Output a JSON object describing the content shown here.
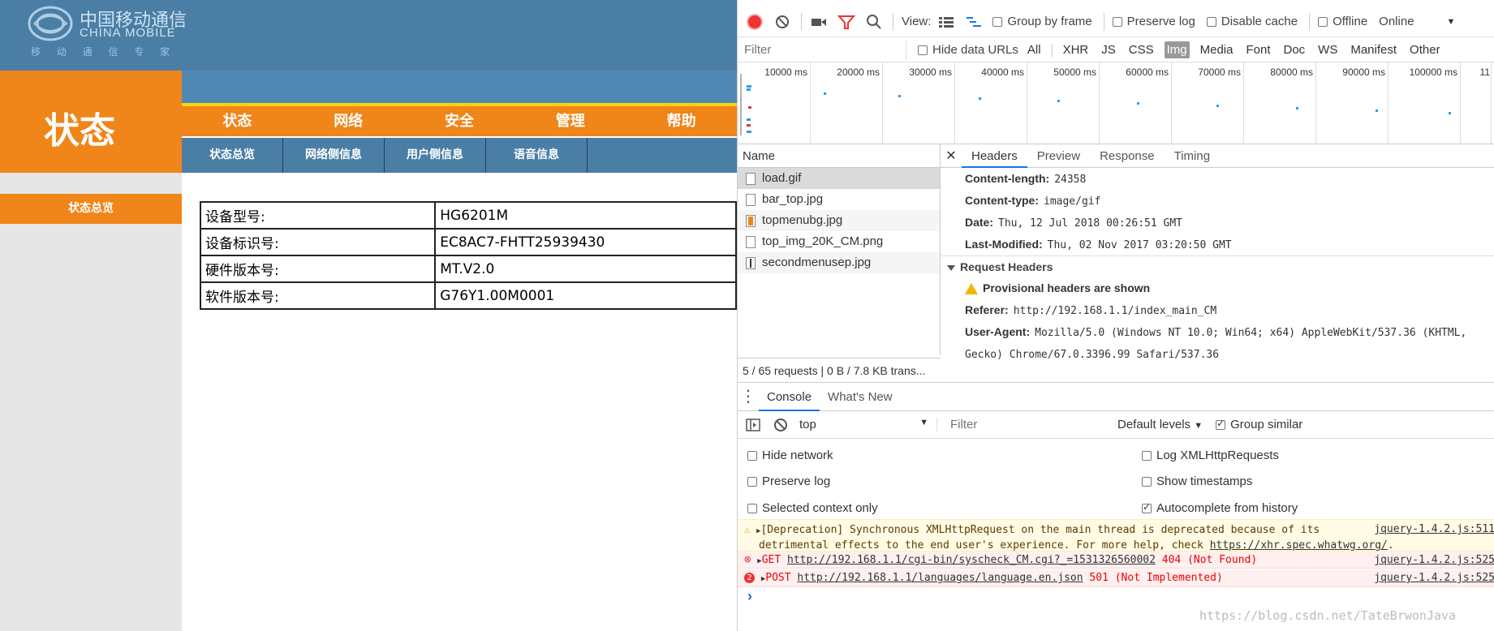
{
  "router": {
    "logo_cn": "中国移动通信",
    "logo_en": "CHINA MOBILE",
    "logo_slogan": "移 动 通 信 专 家",
    "page_title": "状态",
    "menu": [
      "状态",
      "网络",
      "安全",
      "管理",
      "帮助"
    ],
    "submenu": [
      "状态总览",
      "网络侧信息",
      "用户侧信息",
      "语音信息"
    ],
    "sidebar_active": "状态总览",
    "info_rows": [
      {
        "key": "设备型号:",
        "value": "HG6201M"
      },
      {
        "key": "设备标识号:",
        "value": "EC8AC7-FHTT25939430"
      },
      {
        "key": "硬件版本号:",
        "value": "MT.V2.0"
      },
      {
        "key": "软件版本号:",
        "value": "G76Y1.00M0001"
      }
    ],
    "colors": {
      "orange": "#f08519",
      "blue": "#4a7ea5",
      "yellow": "#fbd40a"
    }
  },
  "devtools": {
    "toolbar": {
      "view_label": "View:",
      "group_by_frame": "Group by frame",
      "preserve_log": "Preserve log",
      "disable_cache": "Disable cache",
      "offline": "Offline",
      "throttle": "Online"
    },
    "filter": {
      "placeholder": "Filter",
      "hide_data_urls": "Hide data URLs",
      "types": [
        "All",
        "XHR",
        "JS",
        "CSS",
        "Img",
        "Media",
        "Font",
        "Doc",
        "WS",
        "Manifest",
        "Other"
      ],
      "active_type": "Img"
    },
    "timeline_ticks": [
      "10000 ms",
      "20000 ms",
      "30000 ms",
      "40000 ms",
      "50000 ms",
      "60000 ms",
      "70000 ms",
      "80000 ms",
      "90000 ms",
      "100000 ms",
      "11"
    ],
    "name_header": "Name",
    "files": [
      {
        "name": "load.gif",
        "icon_color": "#ffffff"
      },
      {
        "name": "bar_top.jpg",
        "icon_color": "#ffffff"
      },
      {
        "name": "topmenubg.jpg",
        "icon_color": "#f08519"
      },
      {
        "name": "top_img_20K_CM.png",
        "icon_color": "#ffffff"
      },
      {
        "name": "secondmenusep.jpg",
        "icon_color": "#333333"
      }
    ],
    "status": "5 / 65 requests  |  0 B / 7.8 KB trans...",
    "detail_tabs": [
      "Headers",
      "Preview",
      "Response",
      "Timing"
    ],
    "response_headers": [
      {
        "k": "Content-length:",
        "v": "24358"
      },
      {
        "k": "Content-type:",
        "v": "image/gif"
      },
      {
        "k": "Date:",
        "v": "Thu, 12 Jul 2018 00:26:51 GMT"
      },
      {
        "k": "Last-Modified:",
        "v": "Thu, 02 Nov 2017 03:20:50 GMT"
      }
    ],
    "request_headers_title": "Request Headers",
    "provisional": "Provisional headers are shown",
    "referer": {
      "k": "Referer:",
      "v": "http://192.168.1.1/index_main_CM"
    },
    "user_agent": {
      "k": "User-Agent:",
      "v": "Mozilla/5.0 (Windows NT 10.0; Win64; x64) AppleWebKit/537.36 (KHTML,",
      "v2": "Gecko) Chrome/67.0.3396.99 Safari/537.36"
    },
    "drawer_tabs": [
      "Console",
      "What's New"
    ],
    "console_toolbar": {
      "context": "top",
      "filter_placeholder": "Filter",
      "levels": "Default levels",
      "group_similar": "Group similar"
    },
    "settings_left": [
      "Hide network",
      "Preserve log",
      "Selected context only"
    ],
    "settings_right": [
      "Log XMLHttpRequests",
      "Show timestamps",
      "Autocomplete from history"
    ],
    "messages": {
      "warn_line1": "[Deprecation] Synchronous XMLHttpRequest on the main thread is deprecated because of its",
      "warn_src": "jquery-1.4.2.js:511",
      "warn_line2a": "detrimental effects to the end user's experience. For more help, check ",
      "warn_link": "https://xhr.spec.whatwg.org/",
      "warn_line2b": ".",
      "err1_method": "GET",
      "err1_url": "http://192.168.1.1/cgi-bin/syscheck_CM.cgi?_=1531326560002",
      "err1_status": "404 (Not Found)",
      "err1_src": "jquery-1.4.2.js:525",
      "err2_count": "2",
      "err2_method": "POST",
      "err2_url": "http://192.168.1.1/languages/language.en.json",
      "err2_status": "501 (Not Implemented)",
      "err2_src": "jquery-1.4.2.js:525"
    },
    "prompt": "›"
  },
  "watermark": "https://blog.csdn.net/TateBrwonJava"
}
